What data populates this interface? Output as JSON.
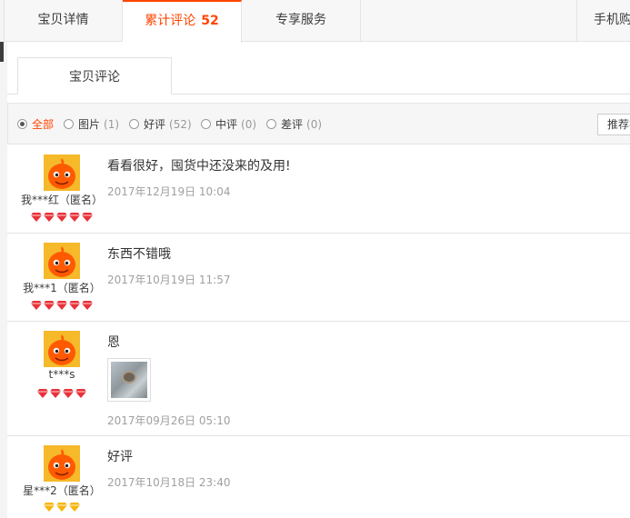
{
  "tabs": {
    "details": "宝贝详情",
    "reviews": "累计评论",
    "reviews_count": "52",
    "service": "专享服务",
    "mobile": "手机购"
  },
  "subtab": "宝贝评论",
  "filters": [
    {
      "label": "全部",
      "count": ""
    },
    {
      "label": "图片",
      "count": "(1)"
    },
    {
      "label": "好评",
      "count": "(52)"
    },
    {
      "label": "中评",
      "count": "(0)"
    },
    {
      "label": "差评",
      "count": "(0)"
    }
  ],
  "sort_label": "推荐排",
  "colors": {
    "accent": "#ff4400",
    "gem_red": "#e8313a",
    "gem_yellow": "#f7b60d"
  },
  "reviews": [
    {
      "user": "我***红（匿名）",
      "text": "看看很好，囤货中还没来的及用!",
      "date": "2017年12月19日 10:04",
      "gem_color": "red",
      "gems": 5
    },
    {
      "user": "我***1（匿名）",
      "text": "东西不错哦",
      "date": "2017年10月19日 11:57",
      "gem_color": "red",
      "gems": 5
    },
    {
      "user": "t***s",
      "text": "恩",
      "date": "2017年09月26日 05:10",
      "gem_color": "red",
      "gems": 4,
      "has_photo": true
    },
    {
      "user": "星***2（匿名）",
      "text": "好评",
      "date": "2017年10月18日 23:40",
      "gem_color": "yellow",
      "gems": 3
    }
  ]
}
